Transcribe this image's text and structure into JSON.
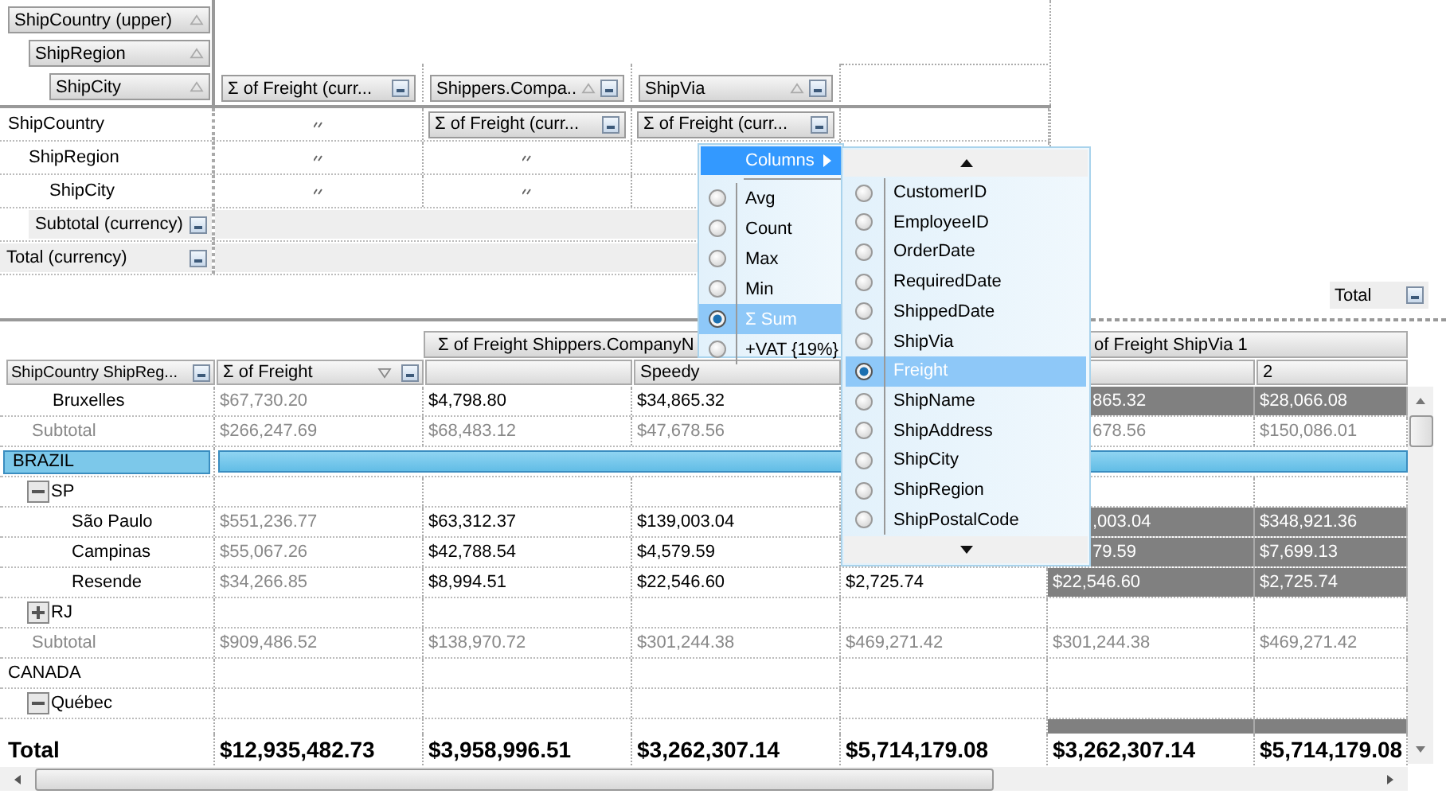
{
  "layout": {
    "row_fields": [
      {
        "label": "ShipCountry (upper)",
        "sortable": true
      },
      {
        "label": "ShipRegion",
        "sortable": true
      },
      {
        "label": "ShipCity",
        "sortable": true
      }
    ],
    "column_fields": [
      {
        "label": "Σ  of Freight (curr...",
        "sortable": false,
        "button": true
      },
      {
        "label": "Shippers.Compa...",
        "sortable": true,
        "button": true
      },
      {
        "label": "ShipVia",
        "sortable": true,
        "button": true
      }
    ],
    "rows": [
      {
        "kind": "field",
        "label": "ShipCountry",
        "cells": [
          {
            "kind": "grip"
          },
          {
            "kind": "value",
            "label": "Σ  of Freight (curr..."
          },
          {
            "kind": "value",
            "label": "Σ  of Freight (curr..."
          }
        ]
      },
      {
        "kind": "field",
        "label": "ShipRegion",
        "cells": [
          {
            "kind": "grip"
          },
          {
            "kind": "grip"
          }
        ]
      },
      {
        "kind": "field",
        "label": "ShipCity",
        "cells": [
          {
            "kind": "grip"
          },
          {
            "kind": "grip"
          }
        ]
      },
      {
        "kind": "subtotal",
        "label": "Subtotal (currency)",
        "button": true
      },
      {
        "kind": "total",
        "label": "Total (currency)",
        "button": true
      }
    ],
    "total_field": {
      "label": "Total",
      "button": true
    }
  },
  "grid": {
    "header_groups": [
      {
        "label": "Σ  of Freight Shippers.CompanyN",
        "partly_hidden": false
      },
      {
        "label": "of Freight ShipVia 1",
        "partly_hidden": true
      }
    ],
    "columns": [
      {
        "label": "ShipCountry ShipReg...",
        "button": true
      },
      {
        "label": "Σ  of Freight",
        "filter": true,
        "button": true,
        "muted": true
      },
      {},
      {
        "label": "Speedy"
      },
      {},
      {},
      {
        "label": "2"
      }
    ],
    "rows": [
      {
        "kind": "city",
        "label": "Bruxelles",
        "partly_hidden": true,
        "cells": [
          {
            "text": "$67,730.20"
          },
          {
            "text": "$4,798.80"
          },
          {
            "text": "$34,865.32"
          },
          {},
          {
            "text": "865.32",
            "highlighted": true
          },
          {
            "text": "$28,066.08",
            "highlighted": true
          }
        ]
      },
      {
        "kind": "subtotal",
        "label": "Subtotal",
        "partly_hidden": true,
        "cells": [
          {
            "text": "$266,247.69"
          },
          {
            "text": "$68,483.12"
          },
          {
            "text": "$47,678.56"
          },
          {},
          {
            "text": "678.56"
          },
          {
            "text": "$150,086.01"
          }
        ]
      },
      {
        "kind": "country",
        "label": "BRAZIL",
        "selected": true,
        "children": [
          {
            "kind": "region",
            "label": "SP",
            "expanded": true,
            "children": [
              {
                "kind": "city",
                "label": "São Paulo",
                "partly_hidden": true,
                "cells": [
                  {
                    "text": "$551,236.77"
                  },
                  {
                    "text": "$63,312.37"
                  },
                  {
                    "text": "$139,003.04"
                  },
                  {},
                  {
                    "text": ",003.04",
                    "highlighted": true
                  },
                  {
                    "text": "$348,921.36",
                    "highlighted": true
                  }
                ]
              },
              {
                "kind": "city",
                "label": "Campinas",
                "partly_hidden": true,
                "cells": [
                  {
                    "text": "$55,067.26"
                  },
                  {
                    "text": "$42,788.54"
                  },
                  {
                    "text": "$4,579.59"
                  },
                  {},
                  {
                    "text": "79.59",
                    "highlighted": true
                  },
                  {
                    "text": "$7,699.13",
                    "highlighted": true
                  }
                ]
              },
              {
                "kind": "city",
                "label": "Resende",
                "cells": [
                  {
                    "text": "$34,266.85"
                  },
                  {
                    "text": "$8,994.51"
                  },
                  {
                    "text": "$22,546.60"
                  },
                  {
                    "text": "$2,725.74"
                  },
                  {
                    "text": "$22,546.60",
                    "highlighted": true
                  },
                  {
                    "text": "$2,725.74",
                    "highlighted": true
                  }
                ]
              }
            ]
          },
          {
            "kind": "region",
            "label": "RJ",
            "expanded": false
          },
          {
            "kind": "subtotal",
            "label": "Subtotal",
            "cells": [
              {
                "text": "$909,486.52"
              },
              {
                "text": "$138,970.72"
              },
              {
                "text": "$301,244.38"
              },
              {
                "text": "$469,271.42"
              },
              {
                "text": "$301,244.38"
              },
              {
                "text": "$469,271.42"
              }
            ]
          }
        ]
      },
      {
        "kind": "country",
        "label": "CANADA",
        "selected": false,
        "children": [
          {
            "kind": "region",
            "label": "Québec",
            "expanded": true,
            "children": [
              {
                "kind": "partial",
                "cells": [
                  {},
                  {},
                  {},
                  {},
                  {
                    "highlighted": true
                  },
                  {
                    "highlighted": true
                  }
                ]
              }
            ]
          }
        ]
      },
      {
        "kind": "total",
        "label": "Total",
        "cells": [
          {
            "text": "$12,935,482.73"
          },
          {
            "text": "$3,958,996.51"
          },
          {
            "text": "$3,262,307.14"
          },
          {
            "text": "$5,714,179.08"
          },
          {
            "text": "$3,262,307.14"
          },
          {
            "text": "$5,714,179.08"
          }
        ]
      }
    ]
  },
  "context_menu": {
    "header": "Columns",
    "items": [
      {
        "label": "Avg",
        "selected": false
      },
      {
        "label": "Count",
        "selected": false
      },
      {
        "label": "Max",
        "selected": false
      },
      {
        "label": "Min",
        "selected": false
      },
      {
        "label": "Σ  Sum",
        "selected": true
      },
      {
        "label": "+VAT {19%}",
        "selected": false
      }
    ]
  },
  "submenu": {
    "items": [
      {
        "label": "CustomerID",
        "selected": false
      },
      {
        "label": "EmployeeID",
        "selected": false
      },
      {
        "label": "OrderDate",
        "selected": false
      },
      {
        "label": "RequiredDate",
        "selected": false
      },
      {
        "label": "ShippedDate",
        "selected": false
      },
      {
        "label": "ShipVia",
        "selected": false
      },
      {
        "label": "Freight",
        "selected": true
      },
      {
        "label": "ShipName",
        "selected": false
      },
      {
        "label": "ShipAddress",
        "selected": false
      },
      {
        "label": "ShipCity",
        "selected": false
      },
      {
        "label": "ShipRegion",
        "selected": false
      },
      {
        "label": "ShipPostalCode",
        "selected": false
      }
    ]
  }
}
